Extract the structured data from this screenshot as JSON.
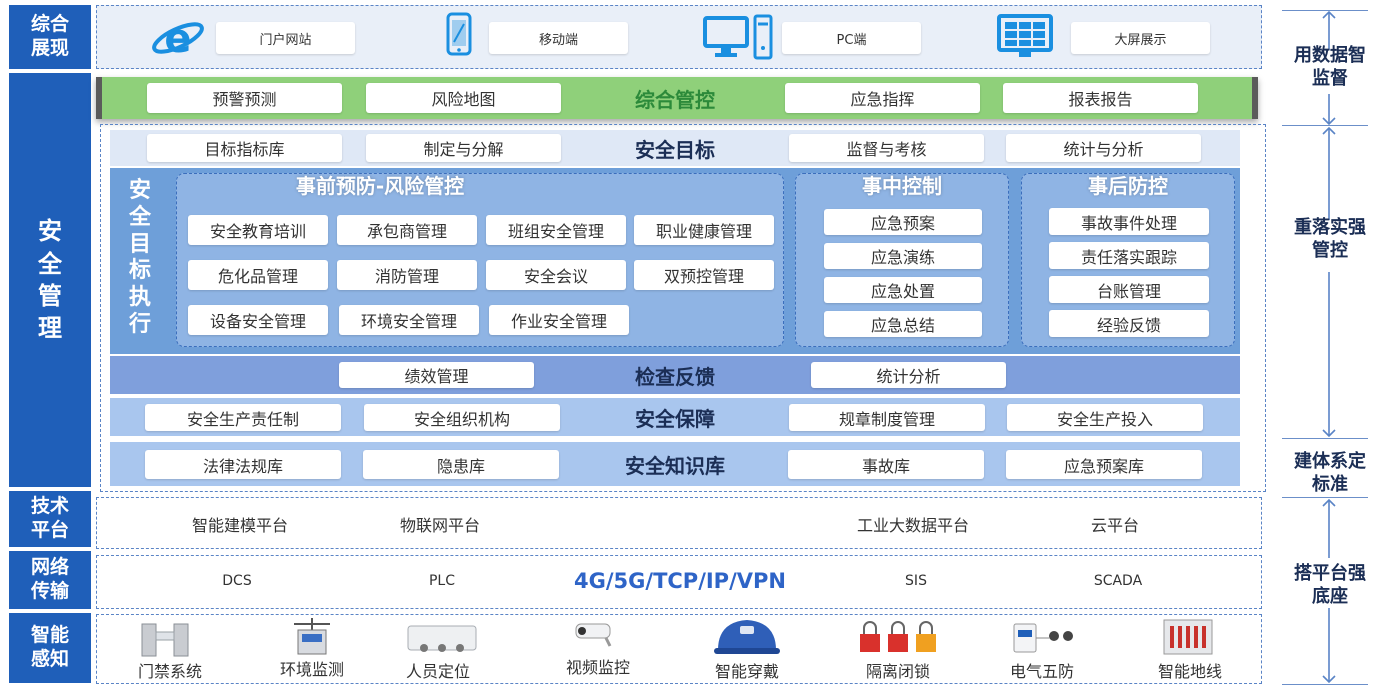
{
  "left_labels": {
    "display": "综合展现",
    "safety": "安全管理",
    "tech": "技术平台",
    "network": "网络传输",
    "sensing": "智能感知"
  },
  "display_row": {
    "items": [
      "门户网站",
      "移动端",
      "PC端",
      "大屏展示"
    ],
    "icons": [
      "ie-browser-icon",
      "mobile-phone-icon",
      "pc-computer-icon",
      "big-screen-icon"
    ]
  },
  "overall_control": {
    "title": "综合管控",
    "items": [
      "预警预测",
      "风险地图",
      "应急指挥",
      "报表报告"
    ]
  },
  "safety_goal": {
    "title": "安全目标",
    "items": [
      "目标指标库",
      "制定与分解",
      "监督与考核",
      "统计与分析"
    ]
  },
  "execution": {
    "label": "安全目标执行",
    "prevention": {
      "title": "事前预防-风险管控",
      "rows": [
        [
          "安全教育培训",
          "承包商管理",
          "班组安全管理",
          "职业健康管理"
        ],
        [
          "危化品管理",
          "消防管理",
          "安全会议",
          "双预控管理"
        ],
        [
          "设备安全管理",
          "环境安全管理",
          "作业安全管理"
        ]
      ]
    },
    "during": {
      "title": "事中控制",
      "items": [
        "应急预案",
        "应急演练",
        "应急处置",
        "应急总结"
      ]
    },
    "after": {
      "title": "事后防控",
      "items": [
        "事故事件处理",
        "责任落实跟踪",
        "台账管理",
        "经验反馈"
      ]
    }
  },
  "inspection": {
    "title": "检查反馈",
    "items": [
      "绩效管理",
      "统计分析"
    ]
  },
  "guarantee": {
    "title": "安全保障",
    "items": [
      "安全生产责任制",
      "安全组织机构",
      "规章制度管理",
      "安全生产投入"
    ]
  },
  "knowledge": {
    "title": "安全知识库",
    "items": [
      "法律法规库",
      "隐患库",
      "事故库",
      "应急预案库"
    ]
  },
  "tech_platform": {
    "items": [
      "智能建模平台",
      "物联网平台",
      "工业大数据平台",
      "云平台"
    ]
  },
  "network": {
    "items": [
      "DCS",
      "PLC",
      "SIS",
      "SCADA"
    ],
    "center": "4G/5G/TCP/IP/VPN"
  },
  "sensing": {
    "items": [
      "门禁系统",
      "环境监测",
      "人员定位",
      "视频监控",
      "智能穿戴",
      "隔离闭锁",
      "电气五防",
      "智能地线"
    ]
  },
  "right_col": {
    "s1": "用数据智监督",
    "s2": "重落实强管控",
    "s3": "建体系定标准",
    "s4": "搭平台强底座"
  },
  "colors": {
    "label_blue": "#1f5fb9",
    "green_bar": "#8fd07a",
    "stage_blue": "#8fb4e4",
    "inspection_blue": "#7f9fdc"
  }
}
